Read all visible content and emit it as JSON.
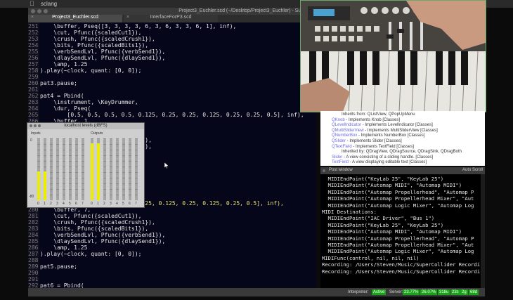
{
  "menubar": {
    "app": "sclang",
    "apple": ""
  },
  "titlebar": {
    "title": "Project3_Euchler.scd (~/Desktop/Project3_Euchler) - SuperCollider IDE"
  },
  "tabs": [
    {
      "label": "Project3_Euchler.scd",
      "active": true
    },
    {
      "label": "InterfaceForP3.scd",
      "active": false
    }
  ],
  "editor": {
    "lines": [
      {
        "n": "251",
        "t": "    \\buffer, Pseq([3, 3, 3, 3, 6, 3, 6, 3, 3, 6, 1], inf),",
        "c": "w"
      },
      {
        "n": "252",
        "t": "    \\cut, Pfunc({scaledCut1}),",
        "c": "w"
      },
      {
        "n": "253",
        "t": "    \\crush, Pfunc({scaledCrush1}),",
        "c": "w"
      },
      {
        "n": "254",
        "t": "    \\bits, Pfunc({scaledBits1}),",
        "c": "w"
      },
      {
        "n": "255",
        "t": "    \\verbSendLvl, Pfunc({verbSend1}),",
        "c": "w"
      },
      {
        "n": "256",
        "t": "    \\dlaySendLvl, Pfunc({dlaySend1}),",
        "c": "w"
      },
      {
        "n": "257",
        "t": "    \\amp, 1.25",
        "c": "w"
      },
      {
        "n": "258",
        "t": ").play(~clock, quant: [0, 0]);",
        "c": "w"
      },
      {
        "n": "259",
        "t": "",
        "c": "w"
      },
      {
        "n": "260",
        "t": "pat3.pause;",
        "c": "w"
      },
      {
        "n": "261",
        "t": "",
        "c": "w"
      },
      {
        "n": "262",
        "t": "pat4 = Pbind(",
        "c": "w"
      },
      {
        "n": "263",
        "t": "    \\instrument, \\KeyDrummer,",
        "c": "w"
      },
      {
        "n": "264",
        "t": "    \\dur, Pseq(",
        "c": "w"
      },
      {
        "n": "265",
        "t": "        [0.5, 0.5, 0.5, 0.5, 0.125, 0.25, 0.25, 0.125, 0.25, 0.25, 0.5], inf),",
        "c": "w"
      },
      {
        "n": "266",
        "t": "    \\buffer, 1,",
        "c": "w"
      },
      {
        "n": "267",
        "t": "",
        "c": "w"
      },
      {
        "n": "268",
        "t": "",
        "c": "w"
      },
      {
        "n": "269",
        "t": "                              )),",
        "c": "w"
      },
      {
        "n": "270",
        "t": "                              )),",
        "c": "w"
      },
      {
        "n": "271",
        "t": "",
        "c": "w"
      },
      {
        "n": "272",
        "t": "",
        "c": "w"
      },
      {
        "n": "273",
        "t": "",
        "c": "w"
      },
      {
        "n": "274",
        "t": "",
        "c": "w"
      },
      {
        "n": "275",
        "t": "",
        "c": "w"
      },
      {
        "n": "276",
        "t": "",
        "c": "w"
      },
      {
        "n": "277",
        "t": "",
        "c": "w"
      },
      {
        "n": "278",
        "t": "",
        "c": "w"
      },
      {
        "n": "279",
        "t": "        [0.125, 0.25, 0.125, 0.25, 0.125, 0.25, 0.125, 0.25, 0.5], inf),",
        "c": "y"
      },
      {
        "n": "280",
        "t": "    \\buffer, 7,",
        "c": "w"
      },
      {
        "n": "281",
        "t": "    \\cut, Pfunc({scaledCut1}),",
        "c": "w"
      },
      {
        "n": "282",
        "t": "    \\crush, Pfunc({scaledCrush1}),",
        "c": "w"
      },
      {
        "n": "283",
        "t": "    \\bits, Pfunc({scaledBits1}),",
        "c": "w"
      },
      {
        "n": "284",
        "t": "    \\verbSendLvl, Pfunc({verbSend1}),",
        "c": "w"
      },
      {
        "n": "285",
        "t": "    \\dlaySendLvl, Pfunc({dlaySend1}),",
        "c": "w"
      },
      {
        "n": "286",
        "t": "    \\amp, 1.25",
        "c": "w"
      },
      {
        "n": "287",
        "t": ").play(~clock, quant: [0, 0]);",
        "c": "w"
      },
      {
        "n": "288",
        "t": "",
        "c": "w"
      },
      {
        "n": "289",
        "t": "pat5.pause;",
        "c": "w"
      },
      {
        "n": "290",
        "t": "",
        "c": "w"
      },
      {
        "n": "291",
        "t": "",
        "c": "w"
      },
      {
        "n": "292",
        "t": "pat6 = Pbind(",
        "c": "w"
      }
    ]
  },
  "levels": {
    "title": "localhost levels (dBFS)",
    "inputs_label": "Inputs",
    "outputs_label": "Outputs",
    "scale_top": "0",
    "scale_bottom": "-80",
    "input_levels": [
      0.47,
      0.47,
      0,
      0,
      0,
      0,
      0,
      0
    ],
    "output_levels": [
      0.92,
      0.92,
      0,
      0,
      0,
      0,
      0,
      0
    ],
    "channel_numbers": [
      "0",
      "1",
      "2",
      "3",
      "4",
      "5",
      "6",
      "7"
    ],
    "meter_color": "#ecec00"
  },
  "video": {
    "description_color": "#3c3a38"
  },
  "help": {
    "lines": [
      {
        "text": "Inherits from: QListView, QPopUpMenu",
        "sub": true,
        "link": ""
      },
      {
        "text": " - Implements Knob [Classes]",
        "sub": false,
        "link": "QKnob"
      },
      {
        "text": " - Implements LevelIndicator [Classes]",
        "sub": false,
        "link": "QLevelIndicator"
      },
      {
        "text": " - Implements MultiSliderView [Classes]",
        "sub": false,
        "link": "QMultiSliderView"
      },
      {
        "text": " - Implements NumberBox [Classes]",
        "sub": false,
        "link": "QNumberBox"
      },
      {
        "text": " - Implements Slider [Classes]",
        "sub": false,
        "link": "QSlider"
      },
      {
        "text": " - Implements TextField [Classes]",
        "sub": false,
        "link": "QTextField"
      },
      {
        "text": "Inherited by: QDragView, QDragSource, QDragSink, QDragBoth",
        "sub": true,
        "link": ""
      },
      {
        "text": " - A view consisting of a sliding handle. [Classes]",
        "sub": false,
        "link": "Slider"
      },
      {
        "text": " - A view displaying editable text [Classes]",
        "sub": false,
        "link": "TextField"
      }
    ]
  },
  "post": {
    "title": "Post window",
    "autoscroll": "Auto Scroll",
    "lines": [
      "  MIDIEndPoint(\"KeyLab 25\", \"KeyLab 25\")",
      "  MIDIEndPoint(\"Automap MIDI\", \"Automap MIDI\")",
      "  MIDIEndPoint(\"Automap Propellerhead\", \"Automap P",
      "  MIDIEndPoint(\"Automap Propellerhead Mixer\", \"Aut",
      "  MIDIEndPoint(\"Automap Logic Mixer\", \"Automap Log",
      "MIDI Destinations:",
      "  MIDIEndPoint(\"IAC Driver\", \"Bus 1\")",
      "  MIDIEndPoint(\"KeyLab 25\", \"KeyLab 25\")",
      "  MIDIEndPoint(\"Automap MIDI\", \"Automap MIDI\")",
      "  MIDIEndPoint(\"Automap Propellerhead\", \"Automap P",
      "  MIDIEndPoint(\"Automap Propellerhead Mixer\", \"Aut",
      "  MIDIEndPoint(\"Automap Logic Mixer\", \"Automap Log",
      "MIDIFunc(control, nil, nil, nil)",
      "Recording: /Users/Steven/Music/SuperCollider Recordi",
      "Recording: /Users/Steven/Music/SuperCollider Recordi"
    ]
  },
  "status": {
    "interpreter_label": "Interpreter:",
    "interpreter_state": "Active",
    "server_label": "Server:",
    "server_cpu_avg": "23.77%",
    "server_cpu_peak": "26.07%",
    "server_ugens": "318u",
    "server_synths": "23s",
    "server_groups": "2g",
    "server_synthdefs": "68d"
  }
}
